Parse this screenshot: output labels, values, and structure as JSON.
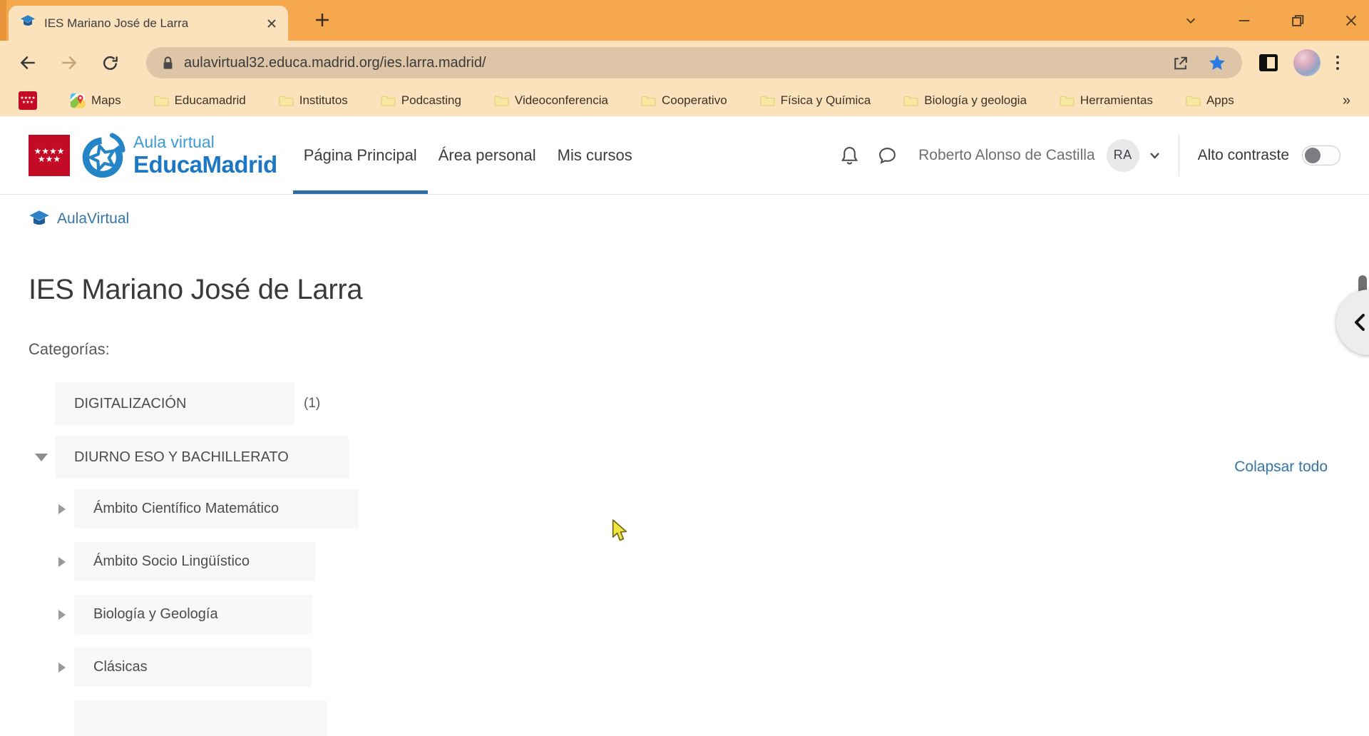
{
  "browser": {
    "tab_title": "IES Mariano José de Larra",
    "url": "aulavirtual32.educa.madrid.org/ies.larra.madrid/",
    "bookmarks": {
      "pinned_label": "Maps",
      "folders": [
        "Educamadrid",
        "Institutos",
        "Podcasting",
        "Videoconferencia",
        "Cooperativo",
        "Física y Química",
        "Biología y geologia",
        "Herramientas",
        "Apps"
      ],
      "overflow": "»"
    }
  },
  "header": {
    "logo_line1": "Aula virtual",
    "logo_line2": "EducaMadrid",
    "nav": [
      {
        "label": "Página Principal",
        "active": true
      },
      {
        "label": "Área personal",
        "active": false
      },
      {
        "label": "Mis cursos",
        "active": false
      }
    ],
    "user_name": "Roberto Alonso de Castilla",
    "user_initials": "RA",
    "contrast_label": "Alto contraste"
  },
  "page": {
    "breadcrumb": "AulaVirtual",
    "title": "IES Mariano José de Larra",
    "categories_label": "Categorías:",
    "collapse_all": "Colapsar todo",
    "categories": [
      {
        "label": "DIGITALIZACIÓN",
        "count": "(1)",
        "level": 0,
        "arrow": "none"
      },
      {
        "label": "DIURNO ESO Y BACHILLERATO",
        "count": "",
        "level": 0,
        "arrow": "down"
      },
      {
        "label": "Ámbito Científico Matemático",
        "count": "",
        "level": 1,
        "arrow": "right"
      },
      {
        "label": "Ámbito Socio Lingüístico",
        "count": "",
        "level": 1,
        "arrow": "right"
      },
      {
        "label": "Biología y Geología",
        "count": "",
        "level": 1,
        "arrow": "right"
      },
      {
        "label": "Clásicas",
        "count": "",
        "level": 1,
        "arrow": "right"
      }
    ]
  },
  "colors": {
    "chrome_orange": "#F5A84E",
    "chrome_pale": "#FCE2BC",
    "url_pill": "#DEC5A7",
    "accent_blue": "#1C77C4",
    "link_blue": "#3575A9",
    "active_underline": "#2C6DA4",
    "flag_red": "#C30B25",
    "row_bg": "#F8F8F8"
  }
}
